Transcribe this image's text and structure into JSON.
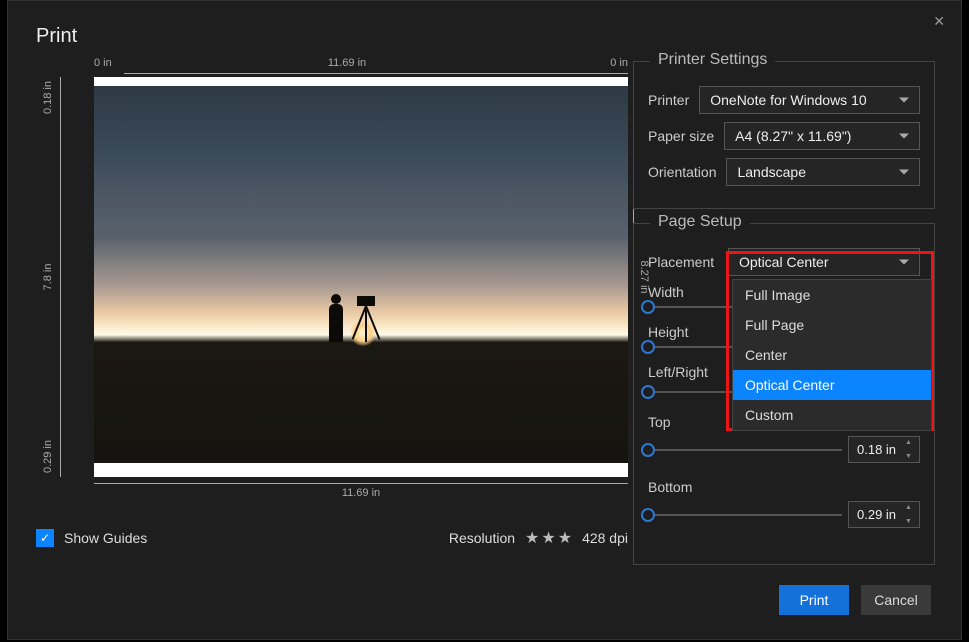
{
  "dialog": {
    "title": "Print"
  },
  "rulers": {
    "zero": "0 in",
    "width": "11.69 in",
    "height": "7.8 in",
    "right_height": "8.27 in",
    "margin_top_label": "0.18 in",
    "margin_bottom_label": "0.29 in"
  },
  "preview_bottom": "11.69 in",
  "show_guides": {
    "label": "Show Guides",
    "checked": true
  },
  "resolution": {
    "label": "Resolution",
    "stars": 3,
    "value": "428 dpi"
  },
  "printer_settings": {
    "title": "Printer Settings",
    "printer": {
      "label": "Printer",
      "value": "OneNote for Windows 10"
    },
    "paper_size": {
      "label": "Paper size",
      "value": "A4 (8.27\" x 11.69\")"
    },
    "orientation": {
      "label": "Orientation",
      "value": "Landscape"
    }
  },
  "page_setup": {
    "title": "Page Setup",
    "placement": {
      "label": "Placement",
      "value": "Optical Center"
    },
    "placement_options": [
      "Full Image",
      "Full Page",
      "Center",
      "Optical Center",
      "Custom"
    ],
    "placement_selected_index": 3,
    "width": {
      "label": "Width"
    },
    "height": {
      "label": "Height"
    },
    "left_right": {
      "label": "Left/Right"
    },
    "top": {
      "label": "Top",
      "value": "0.18 in"
    },
    "bottom": {
      "label": "Bottom",
      "value": "0.29 in"
    }
  },
  "buttons": {
    "print": "Print",
    "cancel": "Cancel"
  }
}
